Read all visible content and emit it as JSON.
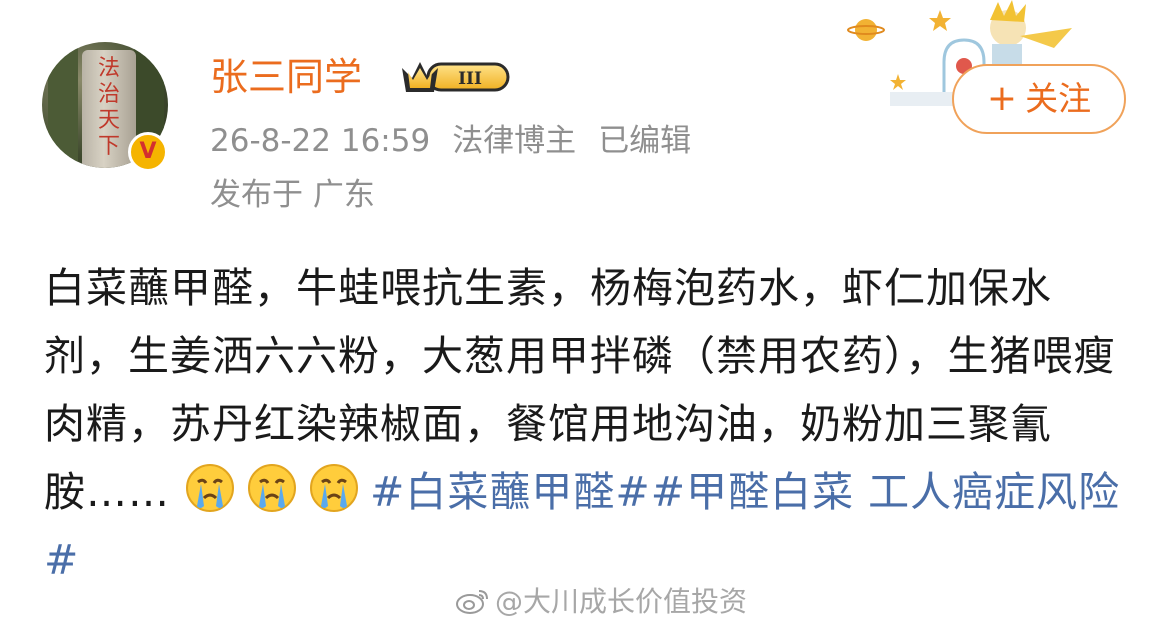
{
  "post": {
    "username": "张三同学",
    "level_badge": "III",
    "date": "26-8-22 16:59",
    "role": "法律博主",
    "edited": "已编辑",
    "location": "发布于 广东",
    "follow_label": "关注",
    "text_1": "白菜蘸甲醛，牛蛙喂抗生素，杨梅泡药水，虾仁加保水剂，生姜洒六六粉，大葱用甲拌磷（禁用农药），生猪喂瘦肉精，苏丹红染辣椒面，餐馆用地沟油，奶粉加三聚氰胺……",
    "hashtag_1": "#白菜蘸甲醛#",
    "hashtag_2": "#甲醛白菜 工人癌症风险#",
    "avatar_calligraphy": "法治天下"
  },
  "watermark": {
    "text": "@大川成长价值投资"
  },
  "icons": {
    "verified": "v-badge-icon",
    "emoji": "crying-face-icon",
    "follow": "plus-icon"
  },
  "colors": {
    "username": "#eb6c1e",
    "hashtag": "#4a6ea8",
    "meta": "#8f8f8f"
  }
}
